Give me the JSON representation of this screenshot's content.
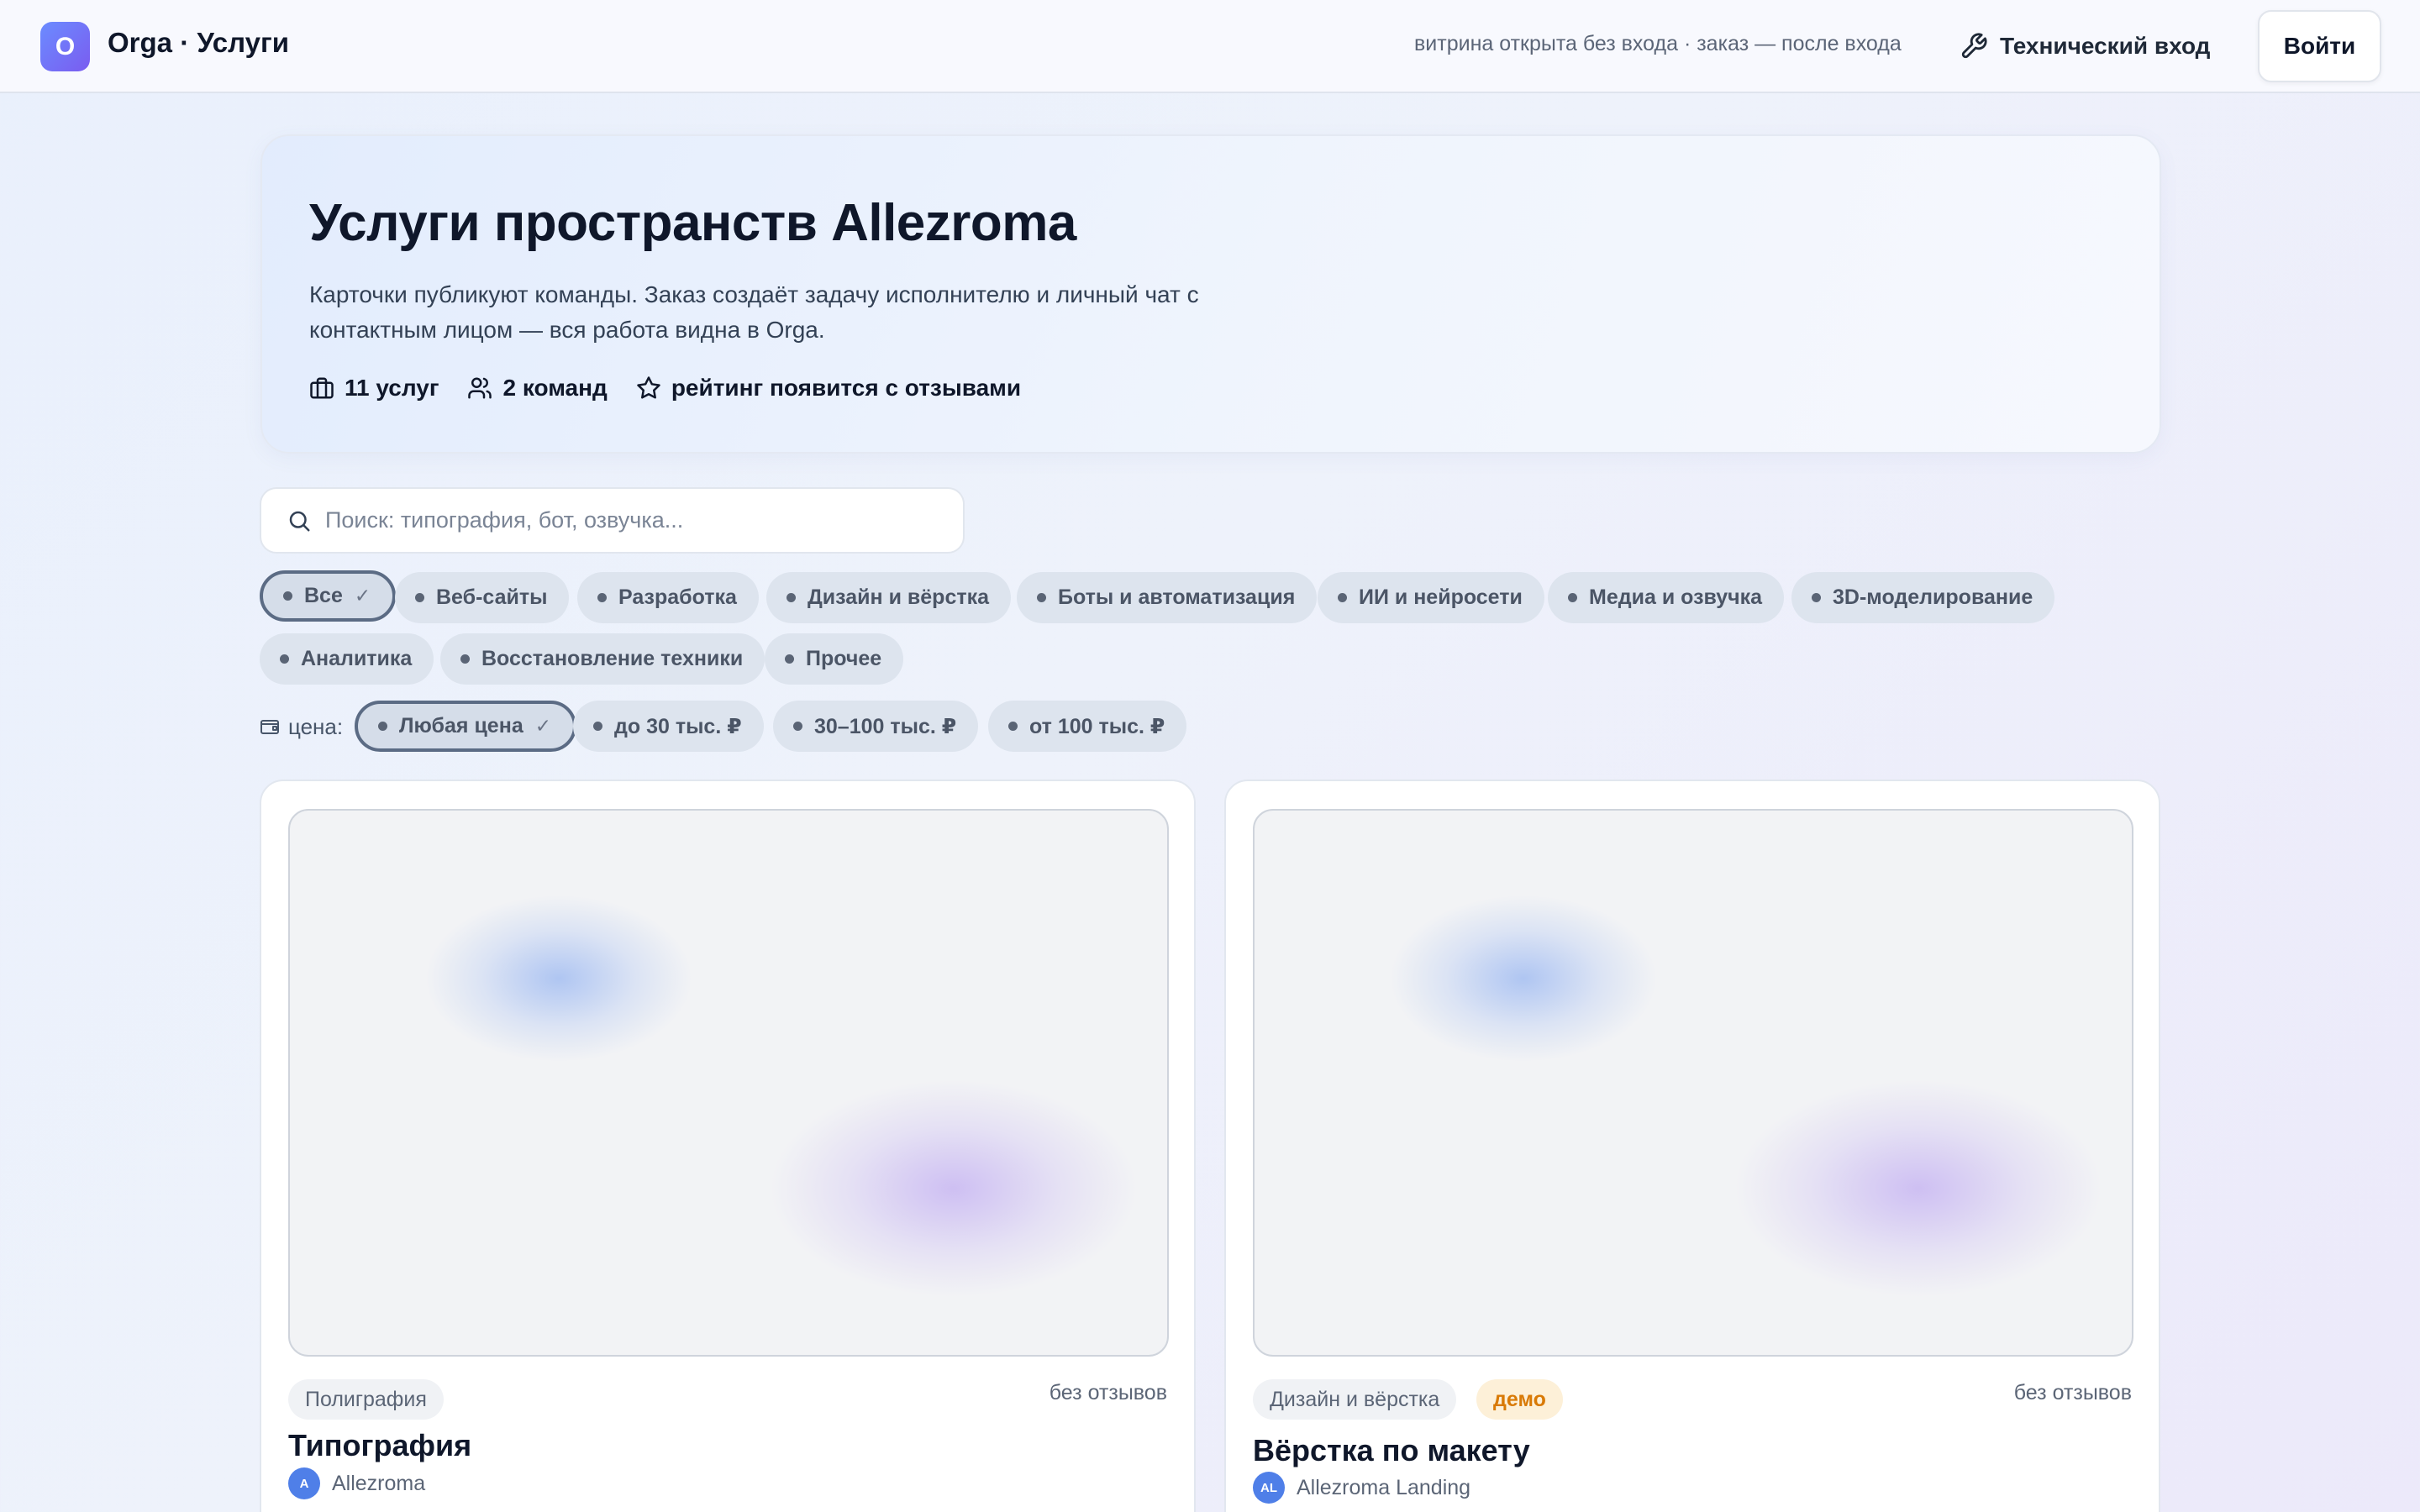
{
  "header": {
    "logo_letter": "O",
    "title": "Orga · Услуги",
    "note": "витрина открыта без входа · заказ — после входа",
    "tech_login": "Технический вход",
    "login": "Войти"
  },
  "hero": {
    "title": "Услуги пространств Allezroma",
    "description": "Карточки публикуют команды. Заказ создаёт задачу исполнителю и личный чат с контактным лицом — вся работа видна в Orga.",
    "stats": {
      "services": "11 услуг",
      "teams": "2 команд",
      "rating": "рейтинг появится с отзывами"
    }
  },
  "search": {
    "placeholder": "Поиск: типография, бот, озвучка...",
    "value": ""
  },
  "categories": [
    {
      "label": "Все",
      "active": true
    },
    {
      "label": "Веб-сайты"
    },
    {
      "label": "Разработка"
    },
    {
      "label": "Дизайн и вёрстка"
    },
    {
      "label": "Боты и автоматизация"
    },
    {
      "label": "ИИ и нейросети"
    },
    {
      "label": "Медиа и озвучка"
    },
    {
      "label": "3D-моделирование"
    },
    {
      "label": "Аналитика"
    },
    {
      "label": "Восстановление техники"
    },
    {
      "label": "Прочее"
    }
  ],
  "price": {
    "label": "цена:",
    "options": [
      {
        "label": "Любая цена",
        "active": true
      },
      {
        "label": "до 30 тыс. ₽"
      },
      {
        "label": "30–100 тыс. ₽"
      },
      {
        "label": "от 100 тыс. ₽"
      }
    ]
  },
  "check_mark": "✓",
  "cards": [
    {
      "category": "Полиграфия",
      "reviews": "без отзывов",
      "title": "Типография",
      "team_initials": "A",
      "team": "Allezroma"
    },
    {
      "category": "Дизайн и вёрстка",
      "demo": "демо",
      "reviews": "без отзывов",
      "title": "Вёрстка по макету",
      "team_initials": "AL",
      "team": "Allezroma Landing"
    }
  ],
  "colors": {
    "accent_gradient_start": "#6b8cff",
    "accent_gradient_end": "#7a5cf0",
    "demo_badge_text": "#d97a06",
    "avatar": "#4f7fe8"
  }
}
